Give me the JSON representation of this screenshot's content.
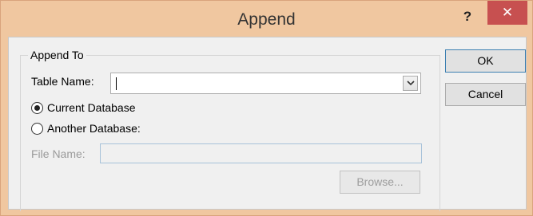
{
  "window": {
    "title": "Append",
    "help_label": "?",
    "close_label": "✕"
  },
  "group": {
    "legend": "Append To",
    "table_name_label": "Table Name:",
    "table_name_value": "",
    "current_db_label": "Current Database",
    "current_db_selected": true,
    "another_db_label": "Another Database:",
    "another_db_selected": false,
    "file_name_label": "File Name:",
    "file_name_value": ""
  },
  "buttons": {
    "ok": "OK",
    "cancel": "Cancel",
    "browse": "Browse..."
  },
  "colors": {
    "frame": "#f0c7a0",
    "close_button": "#c75050",
    "dialog_bg": "#f0f0f0"
  },
  "icons": {
    "dropdown": "chevron-down-icon",
    "close": "close-icon",
    "help": "help-icon"
  }
}
